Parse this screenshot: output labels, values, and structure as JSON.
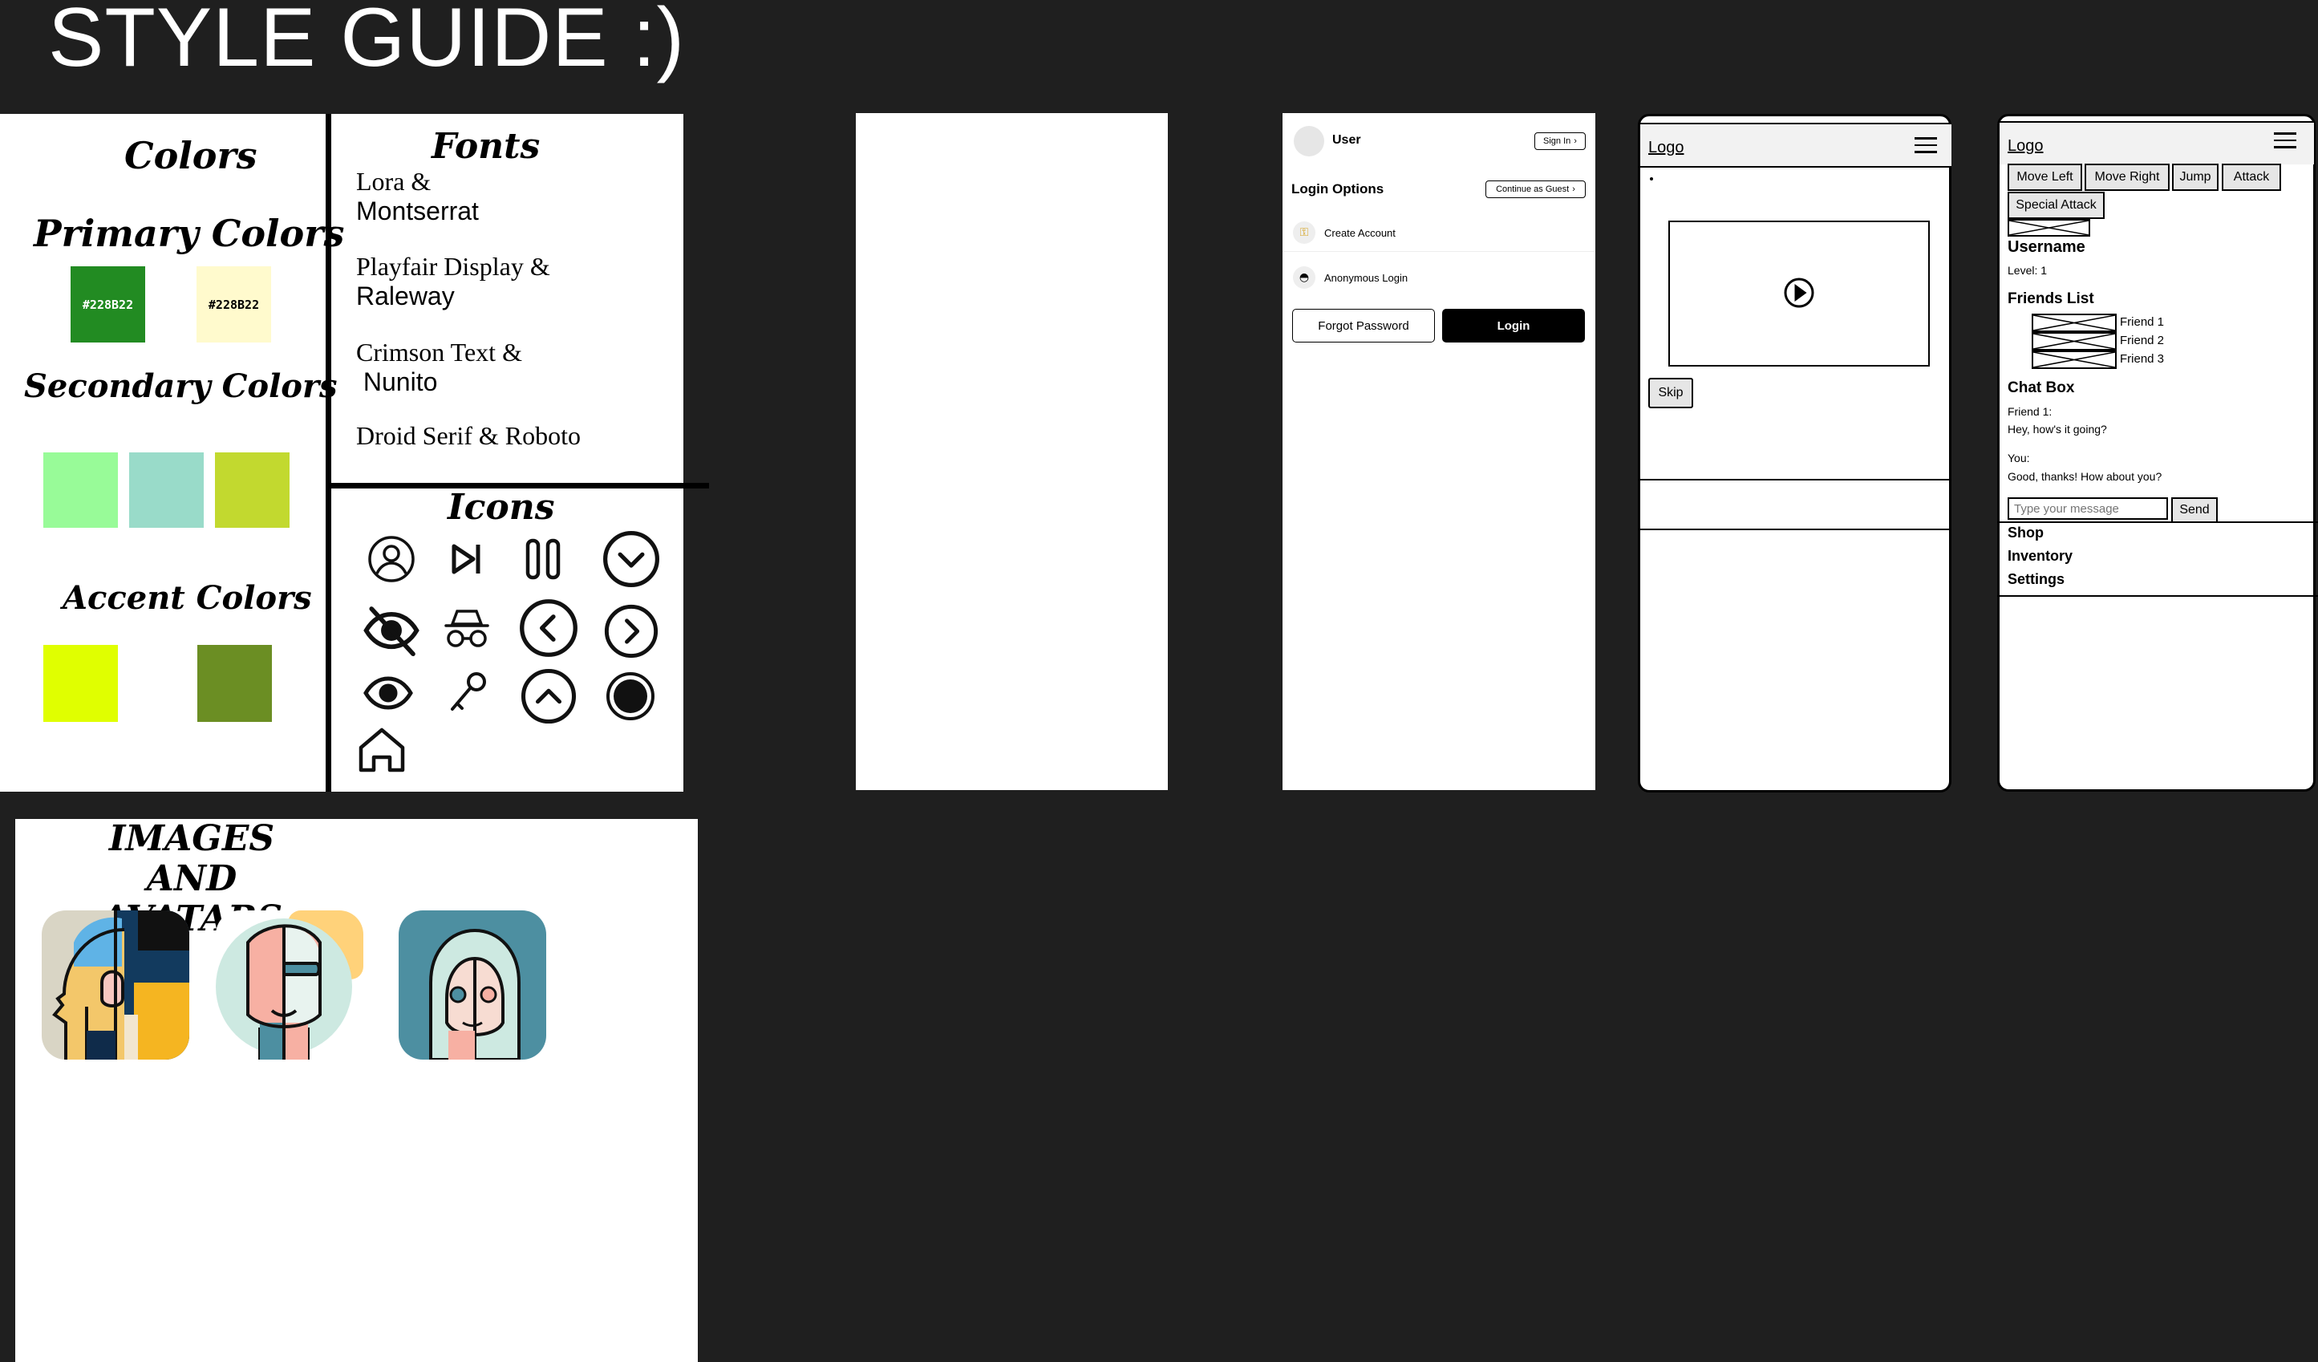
{
  "page_title": "STYLE GUIDE :)",
  "colors_panel": {
    "heading": "Colors",
    "primary": {
      "heading": "Primary Colors",
      "swatches": [
        {
          "label": "#228B22",
          "color": "#228b22",
          "text_color": "#ffffff"
        },
        {
          "label": "#228B22",
          "color": "#fffacd",
          "text_color": "#000000"
        }
      ]
    },
    "secondary": {
      "heading": "Secondary Colors",
      "swatches": [
        {
          "color": "#98fb98"
        },
        {
          "color": "#99dbc9"
        },
        {
          "color": "#c2d92f"
        }
      ]
    },
    "accent": {
      "heading": "Accent Colors",
      "swatches": [
        {
          "color": "#e0ff00"
        },
        {
          "color": "#6b8e23"
        }
      ]
    }
  },
  "fonts_panel": {
    "heading": "Fonts",
    "pairs": [
      {
        "line1": "Lora &",
        "line2": "Montserrat"
      },
      {
        "line1": "Playfair Display &",
        "line2": "Raleway"
      },
      {
        "line1": "Crimson Text &",
        "line2": " Nunito"
      },
      {
        "line1": "Droid Serif & Roboto",
        "line2": ""
      }
    ]
  },
  "icons_panel": {
    "heading": "Icons",
    "icons": [
      "user-circle-icon",
      "skip-next-icon",
      "pause-icon",
      "chevron-down-circle-icon",
      "eye-off-icon",
      "incognito-icon",
      "chevron-left-circle-icon",
      "chevron-right-circle-icon",
      "eye-icon",
      "key-icon",
      "chevron-up-circle-icon",
      "record-icon",
      "home-icon"
    ]
  },
  "images_panel": {
    "heading_line1": "IMAGES AND",
    "heading_line2": "AVATARS",
    "avatars": [
      "avatar-profile-blue-yellow",
      "avatar-face-coral-mint",
      "avatar-face-teal"
    ]
  },
  "login_screen": {
    "user_label": "User",
    "sign_in": "Sign In",
    "options_heading": "Login Options",
    "continue_guest": "Continue as Guest",
    "create_account": "Create Account",
    "anonymous_login": "Anonymous Login",
    "forgot_password": "Forgot Password",
    "login": "Login"
  },
  "video_screen": {
    "logo": "Logo",
    "skip": "Skip"
  },
  "game_screen": {
    "logo": "Logo",
    "actions": [
      "Move Left",
      "Move Right",
      "Jump",
      "Attack",
      "Special Attack"
    ],
    "username": "Username",
    "level": "Level: 1",
    "friends_heading": "Friends List",
    "friends": [
      "Friend 1",
      "Friend 2",
      "Friend 3"
    ],
    "chat_heading": "Chat Box",
    "chat": [
      {
        "sender": "Friend 1:",
        "text": "Hey, how's it going?"
      },
      {
        "sender": "You:",
        "text": "Good, thanks! How about you?"
      }
    ],
    "chat_placeholder": "Type your message",
    "send": "Send",
    "menu": [
      "Shop",
      "Inventory",
      "Settings"
    ]
  }
}
